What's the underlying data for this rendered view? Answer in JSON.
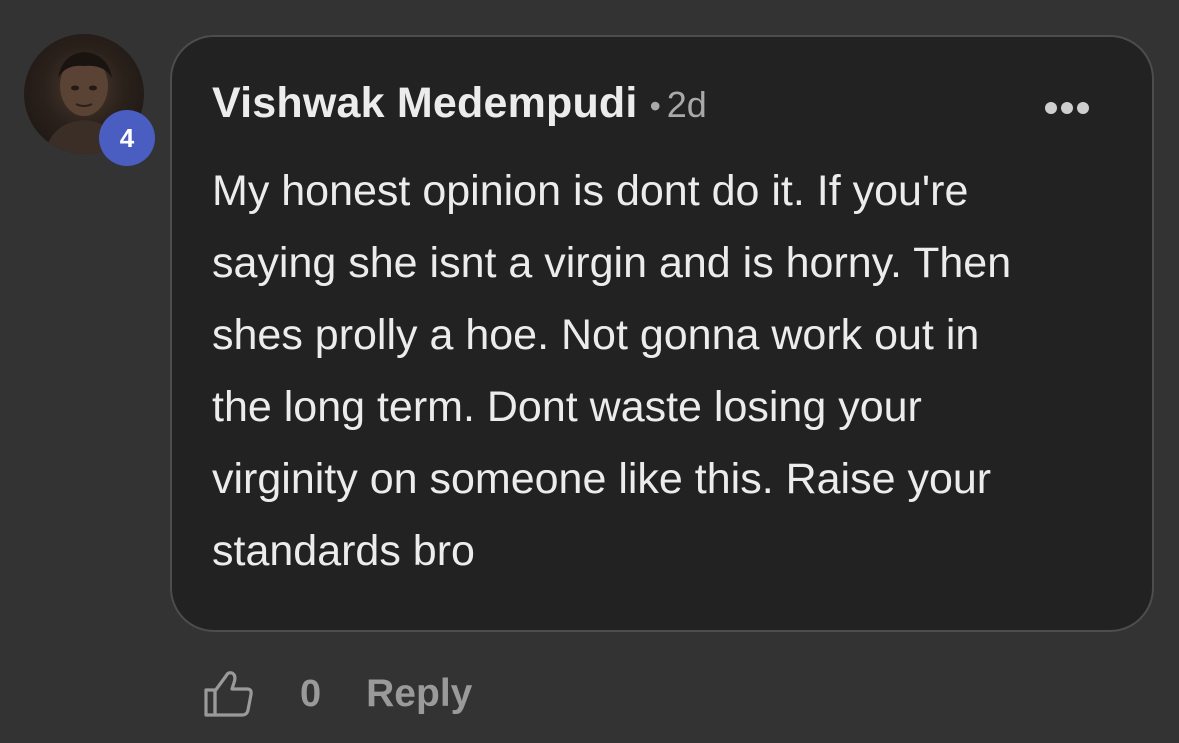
{
  "comment": {
    "avatar_icon": "user-avatar",
    "badge_count": "4",
    "badge_color": "#4a5ec2",
    "author": "Vishwak Medempudi",
    "separator": "•",
    "time_ago": "2d",
    "more_icon": "more-horizontal-icon",
    "lines": [
      "My honest opinion is dont do it. If you're",
      "saying she isnt a virgin and is horny. Then",
      "shes prolly a hoe. Not gonna work out in",
      "the long term. Dont waste losing your",
      "virginity on someone like this. Raise your",
      "standards bro"
    ]
  },
  "actions": {
    "like_icon": "thumbs-up-outline-icon",
    "like_count": "0",
    "reply_label": "Reply"
  },
  "colors": {
    "page_background": "#333333",
    "bubble_background": "#222222",
    "bubble_border": "#4d4d4d",
    "text_primary": "#ececec",
    "text_secondary": "#9a9a9a"
  }
}
